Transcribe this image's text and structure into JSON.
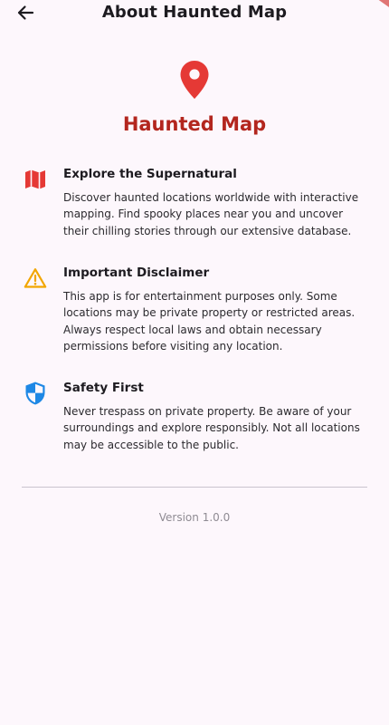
{
  "appbar": {
    "title": "About Haunted Map",
    "back_icon": "arrow-left-icon"
  },
  "hero": {
    "icon": "map-pin-icon",
    "title": "Haunted Map",
    "accent_color": "#b3261e",
    "pin_color": "#e53935"
  },
  "sections": [
    {
      "icon": "map-icon",
      "icon_color": "#e53935",
      "title": "Explore the Supernatural",
      "body": "Discover haunted locations worldwide with interactive mapping. Find spooky places near you and uncover their chilling stories through our extensive database."
    },
    {
      "icon": "warning-icon",
      "icon_color": "#f2a600",
      "title": "Important Disclaimer",
      "body": "This app is for entertainment purposes only. Some locations may be private property or restricted areas. Always respect local laws and obtain necessary permissions before visiting any location."
    },
    {
      "icon": "shield-icon",
      "icon_color": "#1e88e5",
      "title": "Safety First",
      "body": "Never trespass on private property. Be aware of your surroundings and explore responsibly. Not all locations may be accessible to the public."
    }
  ],
  "footer": {
    "version": "Version 1.0.0"
  }
}
